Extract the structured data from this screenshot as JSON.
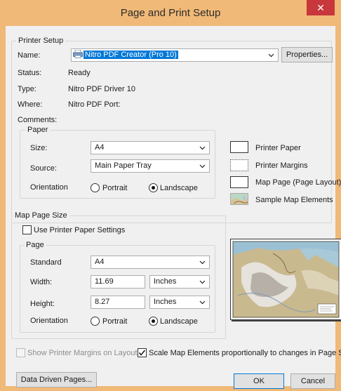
{
  "window": {
    "title": "Page and Print Setup",
    "close_glyph": "✕"
  },
  "printer_setup": {
    "group_label": "Printer Setup",
    "name_label": "Name:",
    "name_value": "Nitro PDF Creator (Pro 10)",
    "properties_button": "Properties...",
    "status_label": "Status:",
    "status_value": "Ready",
    "type_label": "Type:",
    "type_value": "Nitro PDF Driver 10",
    "where_label": "Where:",
    "where_value": "Nitro PDF Port:",
    "comments_label": "Comments:"
  },
  "paper": {
    "group_label": "Paper",
    "size_label": "Size:",
    "size_value": "A4",
    "source_label": "Source:",
    "source_value": "Main Paper Tray",
    "orientation_label": "Orientation",
    "portrait_label": "Portrait",
    "landscape_label": "Landscape",
    "selected": "landscape"
  },
  "legend": {
    "printer_paper": "Printer Paper",
    "printer_margins": "Printer Margins",
    "map_page": "Map Page (Page Layout)",
    "sample_map_elements": "Sample Map Elements"
  },
  "map_page_size": {
    "group_label": "Map Page Size",
    "use_printer_settings_label": "Use Printer Paper Settings",
    "use_printer_settings_checked": false,
    "page_group_label": "Page",
    "standard_label": "Standard",
    "standard_value": "A4",
    "width_label": "Width:",
    "width_value": "11.69",
    "width_unit": "Inches",
    "height_label": "Height:",
    "height_value": "8.27",
    "height_unit": "Inches",
    "orientation_label": "Orientation",
    "portrait_label": "Portrait",
    "landscape_label": "Landscape",
    "selected": "landscape"
  },
  "options": {
    "show_margins_label": "Show Printer Margins on Layout",
    "show_margins_checked": false,
    "scale_elements_label": "Scale Map Elements proportionally to changes in Page Size",
    "scale_elements_checked": true
  },
  "buttons": {
    "data_driven_pages": "Data Driven Pages...",
    "ok": "OK",
    "cancel": "Cancel"
  }
}
